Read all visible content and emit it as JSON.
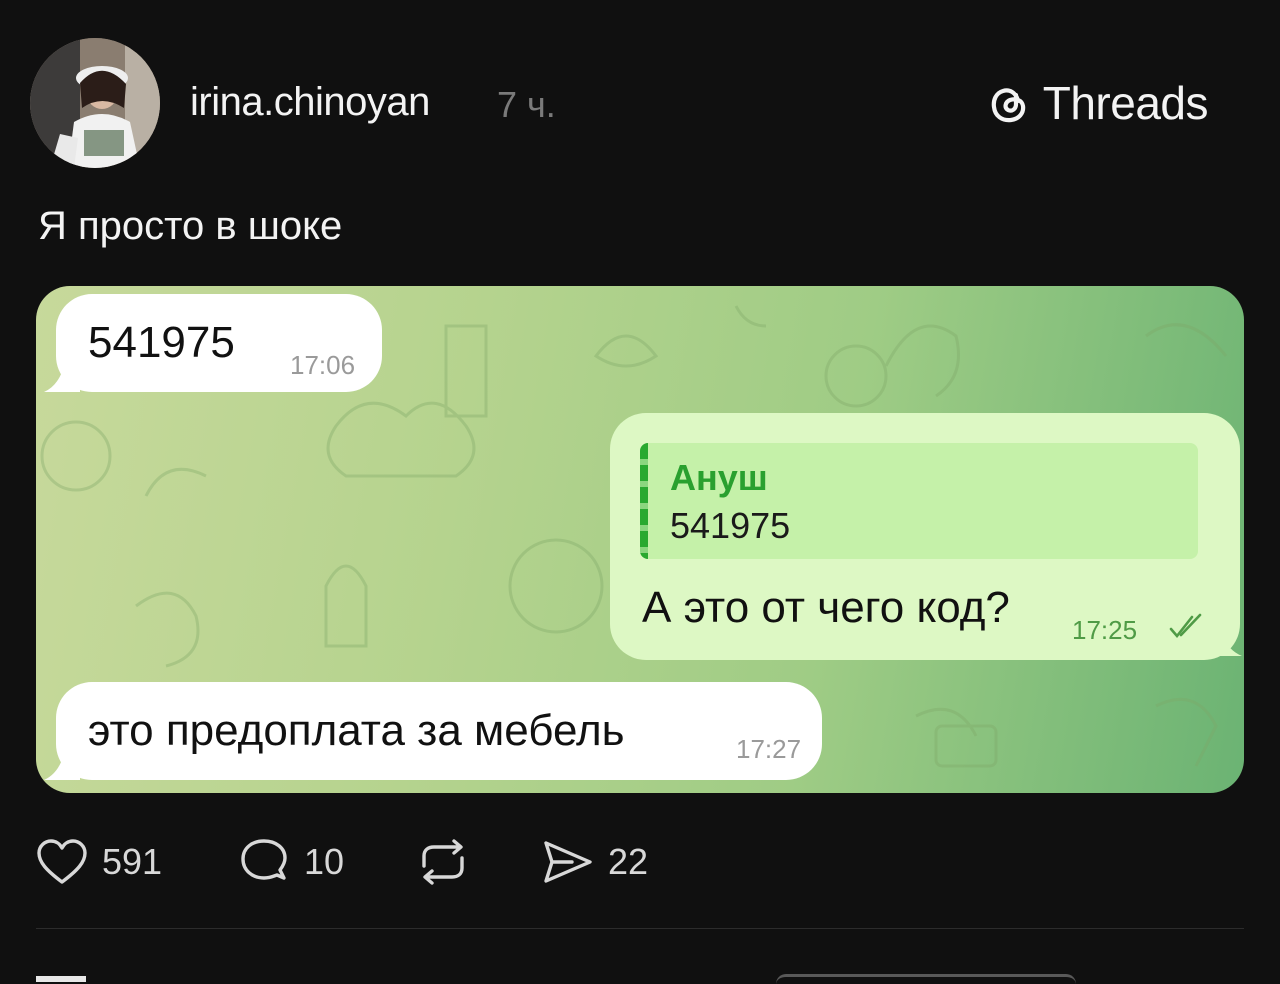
{
  "post": {
    "username": "irina.chinoyan",
    "time_ago": "7 ч.",
    "brand": "Threads",
    "text": "Я просто в шоке"
  },
  "chat": {
    "messages": [
      {
        "type": "incoming",
        "text": "541975",
        "time": "17:06"
      },
      {
        "type": "outgoing",
        "reply_to_name": "Ануш",
        "reply_to_text": "541975",
        "text": "А это от чего код?",
        "time": "17:25",
        "read": true
      },
      {
        "type": "incoming",
        "text": "это предоплата за мебель",
        "time": "17:27"
      }
    ]
  },
  "actions": {
    "likes": "591",
    "comments": "10",
    "shares": "22"
  },
  "colors": {
    "background": "#101010",
    "incoming_bubble": "#ffffff",
    "outgoing_bubble": "#ddf8c4",
    "reply_accent": "#2aa02f"
  },
  "icons": [
    "threads-logo-icon",
    "heart-icon",
    "comment-icon",
    "repost-icon",
    "send-icon",
    "double-check-icon"
  ]
}
